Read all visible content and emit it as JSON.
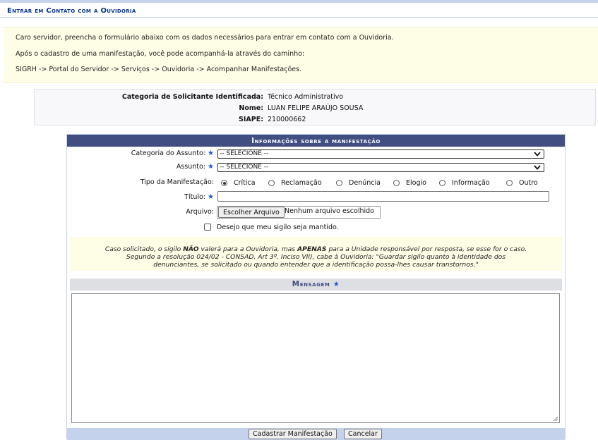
{
  "page": {
    "title": "Entrar em Contato com a Ouvidoria"
  },
  "intro": {
    "line1": "Caro servidor, preencha o formulário abaixo com os dados necessários para entrar em contato com a Ouvidoria.",
    "line2": "Após o cadastro de uma manifestação, você pode acompanhá-la através do caminho:",
    "line3": "SIGRH -> Portal do Servidor -> Serviços -> Ouvidoria -> Acompanhar Manifestações."
  },
  "user": {
    "category_label": "Categoria de Solicitante Identificada:",
    "category_value": "Técnico Administrativo",
    "name_label": "Nome:",
    "name_value": "LUAN FELIPE ARAÚJO SOUSA",
    "siape_label": "SIAPE:",
    "siape_value": "210000662"
  },
  "form": {
    "caption": "Informações sobre a manifestação",
    "categoria_label": "Categoria do Assunto:",
    "categoria_value": "-- SELECIONE --",
    "assunto_label": "Assunto:",
    "assunto_value": "-- SELECIONE --",
    "tipo_label": "Tipo da Manifestação:",
    "tipo_options": [
      "Crítica",
      "Reclamação",
      "Denúncia",
      "Elogio",
      "Informação",
      "Outro"
    ],
    "tipo_selected": "Crítica",
    "titulo_label": "Título:",
    "titulo_value": "",
    "arquivo_label": "Arquivo:",
    "arquivo_button": "Escolher Arquivo",
    "arquivo_status": "Nenhum arquivo escolhido",
    "sigilo_label": "Desejo que meu sigilo seja mantido.",
    "sigilo_checked": false,
    "notice_line1_a": "Caso solicitado, o sigilo ",
    "notice_line1_b": "NÃO",
    "notice_line1_c": " valerá para a Ouvidoria, mas ",
    "notice_line1_d": "APENAS",
    "notice_line1_e": " para a Unidade responsável por resposta, se esse for o caso.",
    "notice_line2": "Segundo a resolução 024/02 - CONSAD, Art 3º. Inciso VII), cabe à Ouvidoria: \"Guardar sigilo quanto à identidade dos",
    "notice_line3": "denunciantes, se solicitado ou quando entender que a identificação possa-lhes causar transtornos.\"",
    "mensagem_label": "Mensagem",
    "mensagem_value": "",
    "required_marker": "★",
    "submit_label": "Cadastrar Manifestação",
    "cancel_label": "Cancelar"
  },
  "colors": {
    "header_bar": "#404E82",
    "title_text": "#003390",
    "notice_bg": "#FEFDE6",
    "footer_bar": "#C4D2EB"
  }
}
